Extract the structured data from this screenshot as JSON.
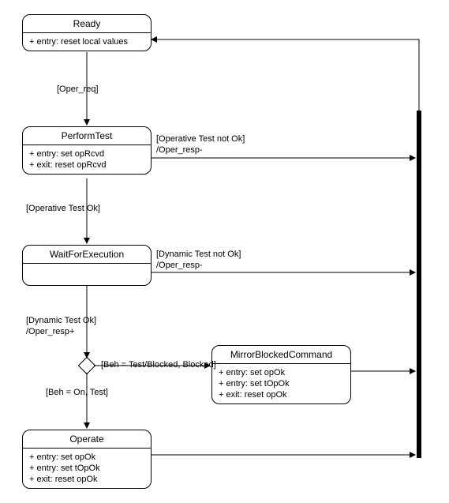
{
  "states": {
    "ready": {
      "title": "Ready",
      "entries": [
        "+ entry: reset local values"
      ]
    },
    "performTest": {
      "title": "PerformTest",
      "entries": [
        "+ entry: set opRcvd",
        "+ exit: reset opRcvd"
      ]
    },
    "waitForExecution": {
      "title": "WaitForExecution",
      "entries": []
    },
    "mirrorBlockedCommand": {
      "title": "MirrorBlockedCommand",
      "entries": [
        "+ entry: set opOk",
        "+ entry: set tOpOk",
        "+ exit: reset opOk"
      ]
    },
    "operate": {
      "title": "Operate",
      "entries": [
        "+ entry: set opOk",
        "+ entry: set tOpOk",
        "+ exit: reset opOk"
      ]
    }
  },
  "labels": {
    "operReq": "[Oper_req]",
    "operativeTestOk": "[Operative Test Ok]",
    "operativeTestNotOk": "[Operative Test not Ok]",
    "operRespMinus1": "/Oper_resp-",
    "dynamicTestNotOk": "[Dynamic Test not Ok]",
    "operRespMinus2": "/Oper_resp-",
    "dynamicTestOk": "[Dynamic Test Ok]",
    "operRespPlus": "/Oper_resp+",
    "behTestBlocked": "[Beh = Test/Blocked, Blocked]",
    "behOnTest": "[Beh = On, Test]"
  }
}
